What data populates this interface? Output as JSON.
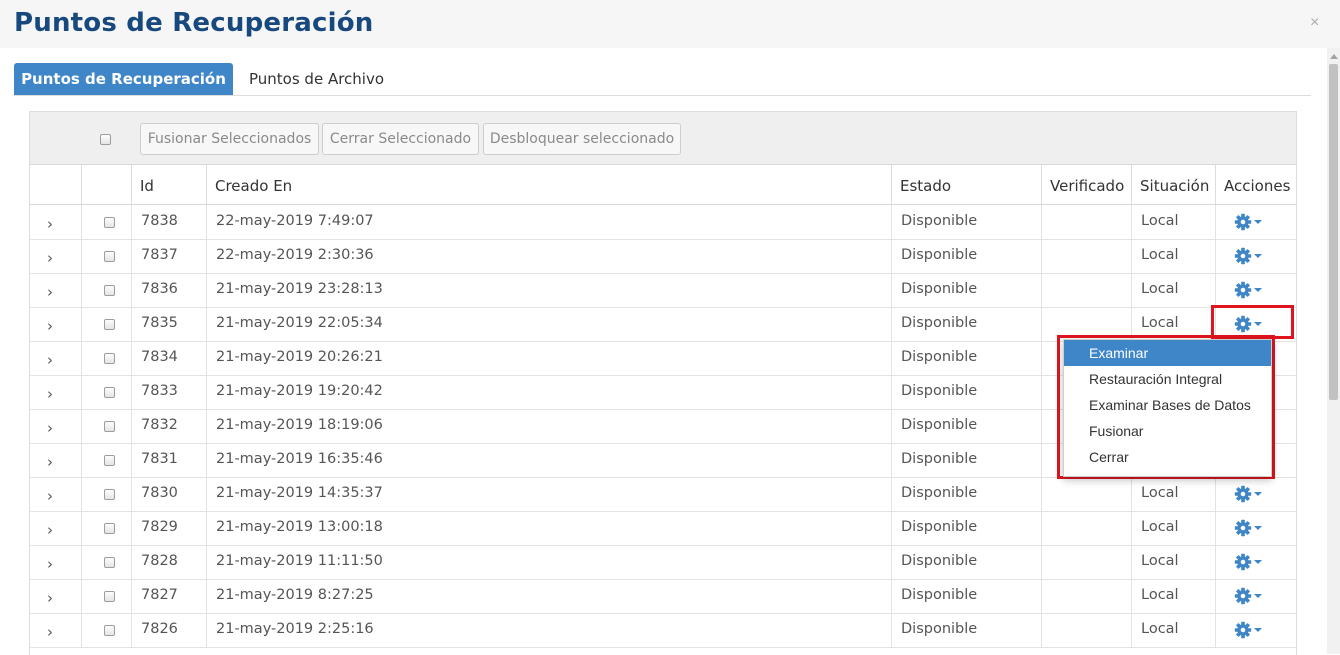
{
  "window": {
    "title": "Puntos de Recuperación",
    "close": "×"
  },
  "tabs": [
    {
      "label": "Puntos de Recuperación",
      "active": true
    },
    {
      "label": "Puntos de Archivo",
      "active": false
    }
  ],
  "toolbar": {
    "merge_label": "Fusionar Seleccionados",
    "close_label": "Cerrar Seleccionado",
    "unlock_label": "Desbloquear seleccionado"
  },
  "columns": {
    "id": "Id",
    "created": "Creado En",
    "state": "Estado",
    "verified": "Verificado",
    "location": "Situación",
    "actions": "Acciones"
  },
  "rows": [
    {
      "id": "7838",
      "created": "22-may-2019 7:49:07",
      "state": "Disponible",
      "verified": "",
      "location": "Local"
    },
    {
      "id": "7837",
      "created": "22-may-2019 2:30:36",
      "state": "Disponible",
      "verified": "",
      "location": "Local"
    },
    {
      "id": "7836",
      "created": "21-may-2019 23:28:13",
      "state": "Disponible",
      "verified": "",
      "location": "Local"
    },
    {
      "id": "7835",
      "created": "21-may-2019 22:05:34",
      "state": "Disponible",
      "verified": "",
      "location": "Local"
    },
    {
      "id": "7834",
      "created": "21-may-2019 20:26:21",
      "state": "Disponible",
      "verified": "",
      "location": ""
    },
    {
      "id": "7833",
      "created": "21-may-2019 19:20:42",
      "state": "Disponible",
      "verified": "",
      "location": ""
    },
    {
      "id": "7832",
      "created": "21-may-2019 18:19:06",
      "state": "Disponible",
      "verified": "",
      "location": ""
    },
    {
      "id": "7831",
      "created": "21-may-2019 16:35:46",
      "state": "Disponible",
      "verified": "",
      "location": ""
    },
    {
      "id": "7830",
      "created": "21-may-2019 14:35:37",
      "state": "Disponible",
      "verified": "",
      "location": "Local"
    },
    {
      "id": "7829",
      "created": "21-may-2019 13:00:18",
      "state": "Disponible",
      "verified": "",
      "location": "Local"
    },
    {
      "id": "7828",
      "created": "21-may-2019 11:11:50",
      "state": "Disponible",
      "verified": "",
      "location": "Local"
    },
    {
      "id": "7827",
      "created": "21-may-2019 8:27:25",
      "state": "Disponible",
      "verified": "",
      "location": "Local"
    },
    {
      "id": "7826",
      "created": "21-may-2019 2:25:16",
      "state": "Disponible",
      "verified": "",
      "location": "Local"
    }
  ],
  "actions_menu": {
    "items": [
      "Examinar",
      "Restauración Integral",
      "Examinar Bases de Datos",
      "Fusionar",
      "Cerrar"
    ],
    "active_index": 0
  },
  "icons": {
    "row_expander": "chevron-right-icon",
    "row_action": "gear-icon",
    "action_caret": "caret-down-icon"
  },
  "colors": {
    "title": "#17497f",
    "accent": "#3f86c8",
    "highlight": "#e0141e",
    "gear": "#3f86c8"
  }
}
